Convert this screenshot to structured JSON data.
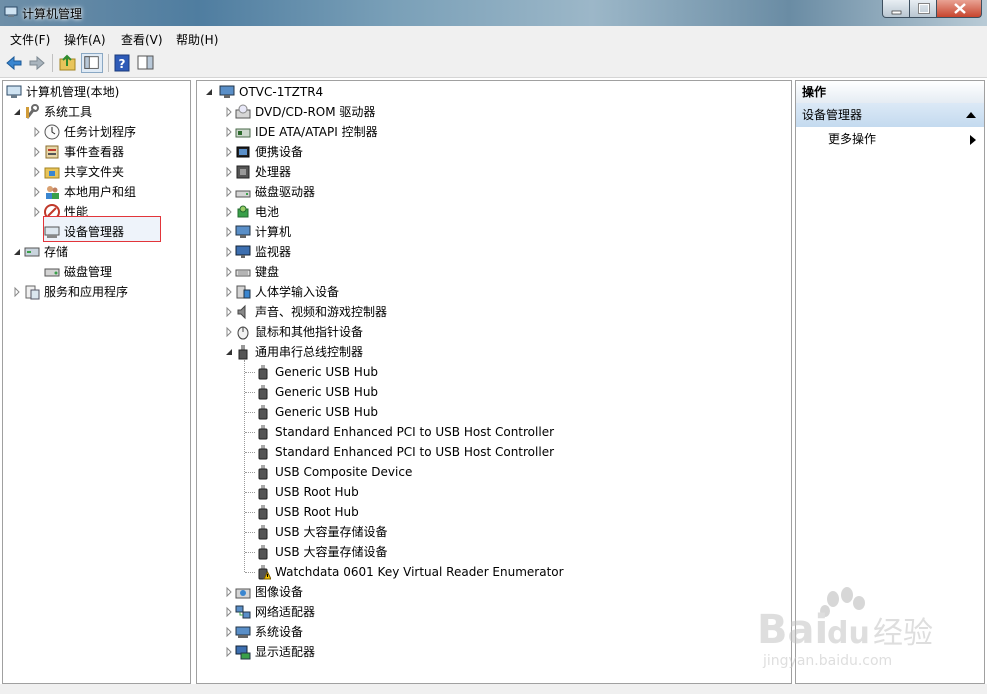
{
  "window": {
    "title": "计算机管理"
  },
  "menu": [
    "文件(F)",
    "操作(A)",
    "查看(V)",
    "帮助(H)"
  ],
  "left_tree": [
    {
      "label": "计算机管理(本地)",
      "icon": "computer-management-icon",
      "level": 0,
      "expand": "none"
    },
    {
      "label": "系统工具",
      "icon": "system-tools-icon",
      "level": 1,
      "expand": "open"
    },
    {
      "label": "任务计划程序",
      "icon": "clock-icon",
      "level": 2,
      "expand": "closed"
    },
    {
      "label": "事件查看器",
      "icon": "event-viewer-icon",
      "level": 2,
      "expand": "closed"
    },
    {
      "label": "共享文件夹",
      "icon": "shared-folder-icon",
      "level": 2,
      "expand": "closed"
    },
    {
      "label": "本地用户和组",
      "icon": "users-icon",
      "level": 2,
      "expand": "closed"
    },
    {
      "label": "性能",
      "icon": "performance-icon",
      "level": 2,
      "expand": "closed"
    },
    {
      "label": "设备管理器",
      "icon": "device-manager-icon",
      "level": 2,
      "expand": "none",
      "selected": true
    },
    {
      "label": "存储",
      "icon": "storage-icon",
      "level": 1,
      "expand": "open"
    },
    {
      "label": "磁盘管理",
      "icon": "disk-icon",
      "level": 2,
      "expand": "none"
    },
    {
      "label": "服务和应用程序",
      "icon": "services-icon",
      "level": 1,
      "expand": "closed"
    }
  ],
  "device_tree": {
    "root": "OTVC-1TZTR4",
    "categories": [
      {
        "label": "DVD/CD-ROM 驱动器",
        "icon": "dvd-drive-icon"
      },
      {
        "label": "IDE ATA/ATAPI 控制器",
        "icon": "ide-controller-icon"
      },
      {
        "label": "便携设备",
        "icon": "portable-device-icon"
      },
      {
        "label": "处理器",
        "icon": "processor-icon"
      },
      {
        "label": "磁盘驱动器",
        "icon": "disk-drive-icon"
      },
      {
        "label": "电池",
        "icon": "battery-icon"
      },
      {
        "label": "计算机",
        "icon": "computer-icon"
      },
      {
        "label": "监视器",
        "icon": "monitor-icon"
      },
      {
        "label": "键盘",
        "icon": "keyboard-icon"
      },
      {
        "label": "人体学输入设备",
        "icon": "hid-icon"
      },
      {
        "label": "声音、视频和游戏控制器",
        "icon": "speaker-icon"
      },
      {
        "label": "鼠标和其他指针设备",
        "icon": "mouse-icon"
      },
      {
        "label": "通用串行总线控制器",
        "icon": "usb-icon",
        "expanded": true,
        "children": [
          {
            "label": "Generic USB Hub",
            "icon": "usb-plug-icon"
          },
          {
            "label": "Generic USB Hub",
            "icon": "usb-plug-icon"
          },
          {
            "label": "Generic USB Hub",
            "icon": "usb-plug-icon"
          },
          {
            "label": "Standard Enhanced PCI to USB Host Controller",
            "icon": "usb-plug-icon"
          },
          {
            "label": "Standard Enhanced PCI to USB Host Controller",
            "icon": "usb-plug-icon"
          },
          {
            "label": "USB Composite Device",
            "icon": "usb-plug-icon"
          },
          {
            "label": "USB Root Hub",
            "icon": "usb-plug-icon"
          },
          {
            "label": "USB Root Hub",
            "icon": "usb-plug-icon"
          },
          {
            "label": "USB 大容量存储设备",
            "icon": "usb-plug-icon"
          },
          {
            "label": "USB 大容量存储设备",
            "icon": "usb-plug-icon"
          },
          {
            "label": "Watchdata 0601 Key Virtual Reader Enumerator",
            "icon": "warning-usb-icon"
          }
        ]
      },
      {
        "label": "图像设备",
        "icon": "imaging-device-icon"
      },
      {
        "label": "网络适配器",
        "icon": "network-adapter-icon"
      },
      {
        "label": "系统设备",
        "icon": "system-device-icon"
      },
      {
        "label": "显示适配器",
        "icon": "display-adapter-icon"
      }
    ]
  },
  "actions": {
    "header": "操作",
    "section": "设备管理器",
    "items": [
      "更多操作"
    ]
  },
  "watermark": {
    "logo": "Bai du 经验",
    "url": "jingyan.baidu.com"
  }
}
